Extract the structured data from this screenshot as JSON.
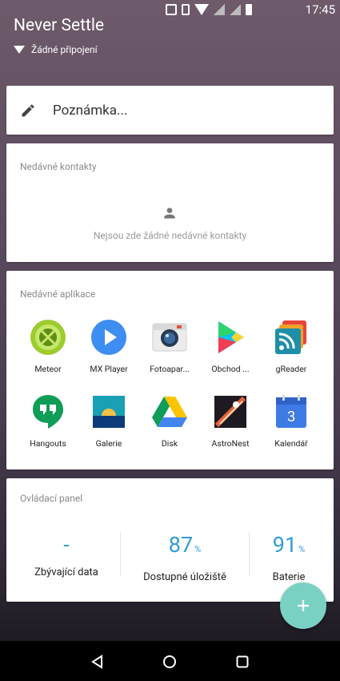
{
  "status_bar": {
    "time": "17:45"
  },
  "header": {
    "title": "Never Settle",
    "subtitle": "Žádné připojení"
  },
  "note": {
    "placeholder": "Poznámka..."
  },
  "contacts": {
    "title": "Nedávné kontakty",
    "empty_text": "Nejsou zde žádné nedávné kontakty"
  },
  "apps": {
    "title": "Nedávné aplikace",
    "items": [
      {
        "label": "Meteor",
        "icon": "meteor-icon"
      },
      {
        "label": "MX Player",
        "icon": "mx-player-icon"
      },
      {
        "label": "Fotoapar...",
        "icon": "camera-icon"
      },
      {
        "label": "Obchod ...",
        "icon": "play-store-icon"
      },
      {
        "label": "gReader",
        "icon": "greader-icon"
      },
      {
        "label": "Hangouts",
        "icon": "hangouts-icon"
      },
      {
        "label": "Galerie",
        "icon": "gallery-icon"
      },
      {
        "label": "Disk",
        "icon": "drive-icon"
      },
      {
        "label": "AstroNest",
        "icon": "astronest-icon"
      },
      {
        "label": "Kalendář",
        "icon": "calendar-icon",
        "badge": "3"
      }
    ]
  },
  "dashboard": {
    "title": "Ovládací panel",
    "metrics": [
      {
        "value": "-",
        "unit": "",
        "label": "Zbývající data"
      },
      {
        "value": "87",
        "unit": "%",
        "label": "Dostupné úložiště"
      },
      {
        "value": "91",
        "unit": "%",
        "label": "Baterie"
      }
    ]
  },
  "fab": {
    "icon": "plus-icon"
  },
  "nav": {
    "back": "back-icon",
    "home": "home-icon",
    "recents": "recents-icon"
  },
  "colors": {
    "accent": "#2f9cd6",
    "fab": "#79d1c4"
  }
}
